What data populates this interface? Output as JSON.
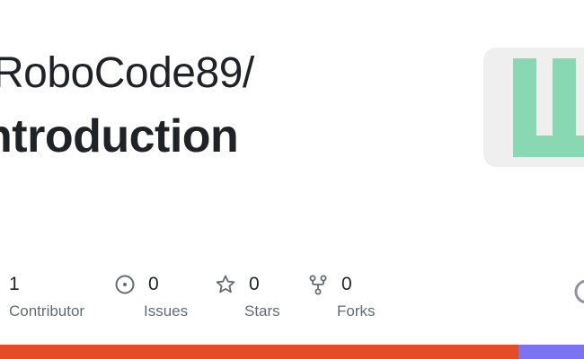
{
  "repo_card": {
    "owner": "RoboCode89/",
    "name": "ntroduction"
  },
  "stats": [
    {
      "icon": "people-icon",
      "count": "1",
      "label": "Contributor"
    },
    {
      "icon": "issue-icon",
      "count": "0",
      "label": "Issues"
    },
    {
      "icon": "star-icon",
      "count": "0",
      "label": "Stars"
    },
    {
      "icon": "fork-icon",
      "count": "0",
      "label": "Forks"
    }
  ],
  "avatar": {
    "icon": "identicon",
    "color": "#89d8b4",
    "background": "#efefef"
  },
  "languages": [
    {
      "color": "#e34c26",
      "fraction": 0.888
    },
    {
      "color": "#7b73f0",
      "fraction": 0.112
    }
  ],
  "colors": {
    "text": "#1f2328",
    "muted": "#636c76"
  }
}
